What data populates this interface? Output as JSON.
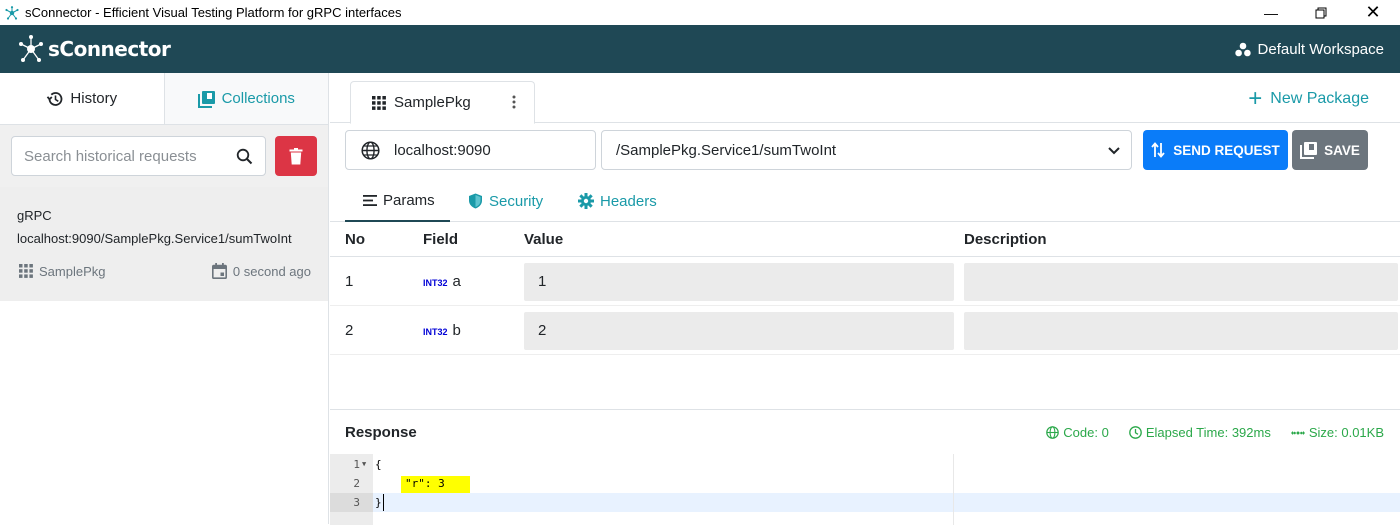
{
  "window": {
    "title": "sConnector - Efficient Visual Testing Platform for gRPC interfaces"
  },
  "header": {
    "logo_text": "sConnector",
    "workspace": "Default Workspace"
  },
  "sidebar": {
    "tabs": [
      {
        "label": "History",
        "active": true
      },
      {
        "label": "Collections",
        "active": false
      }
    ],
    "search": {
      "placeholder": "Search historical requests",
      "value": ""
    },
    "history": [
      {
        "protocol": "gRPC",
        "url": "localhost:9090/SamplePkg.Service1/sumTwoInt",
        "package": "SamplePkg",
        "time": "0 second ago"
      }
    ]
  },
  "main": {
    "package_tab": "SamplePkg",
    "new_package_label": "New Package",
    "host": "localhost:9090",
    "method": "/SamplePkg.Service1/sumTwoInt",
    "send_label": "SEND REQUEST",
    "save_label": "SAVE",
    "param_tabs": [
      {
        "label": "Params",
        "active": true
      },
      {
        "label": "Security",
        "active": false
      },
      {
        "label": "Headers",
        "active": false
      }
    ],
    "table": {
      "headers": [
        "No",
        "Field",
        "Value",
        "Description"
      ],
      "rows": [
        {
          "no": "1",
          "type": "INT32",
          "field": "a",
          "value": "1",
          "description": ""
        },
        {
          "no": "2",
          "type": "INT32",
          "field": "b",
          "value": "2",
          "description": ""
        }
      ]
    },
    "response": {
      "title": "Response",
      "code": "Code: 0",
      "elapsed": "Elapsed Time: 392ms",
      "size": "Size: 0.01KB",
      "lines": [
        {
          "no": "1",
          "text": "{"
        },
        {
          "no": "2",
          "text": "\"r\": 3"
        },
        {
          "no": "3",
          "text": "}"
        }
      ]
    }
  },
  "colors": {
    "header_bg": "#1f4855",
    "accent": "#1a9aa8",
    "send": "#0a7cf9",
    "delete": "#dc3545",
    "save": "#6c757d",
    "status_ok": "#2ba84a"
  }
}
